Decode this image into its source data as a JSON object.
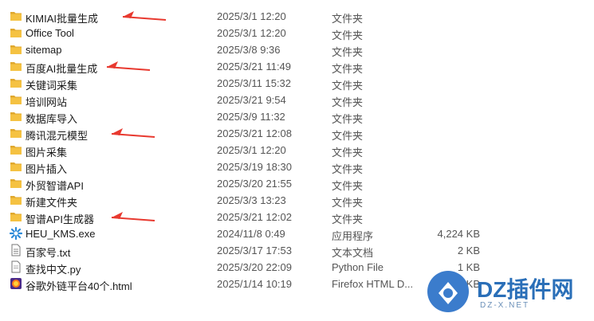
{
  "files": [
    {
      "name": "KIMIAI批量生成",
      "date": "2025/3/1 12:20",
      "type": "文件夹",
      "size": "",
      "icon": "folder-icon",
      "arrow": true
    },
    {
      "name": "Office Tool",
      "date": "2025/3/1 12:20",
      "type": "文件夹",
      "size": "",
      "icon": "folder-icon",
      "arrow": false
    },
    {
      "name": "sitemap",
      "date": "2025/3/8 9:36",
      "type": "文件夹",
      "size": "",
      "icon": "folder-icon",
      "arrow": false
    },
    {
      "name": "百度AI批量生成",
      "date": "2025/3/21 11:49",
      "type": "文件夹",
      "size": "",
      "icon": "folder-icon",
      "arrow": true
    },
    {
      "name": "关键词采集",
      "date": "2025/3/11 15:32",
      "type": "文件夹",
      "size": "",
      "icon": "folder-icon",
      "arrow": false
    },
    {
      "name": "培训网站",
      "date": "2025/3/21 9:54",
      "type": "文件夹",
      "size": "",
      "icon": "folder-icon",
      "arrow": false
    },
    {
      "name": "数据库导入",
      "date": "2025/3/9 11:32",
      "type": "文件夹",
      "size": "",
      "icon": "folder-icon",
      "arrow": false
    },
    {
      "name": "腾讯混元模型",
      "date": "2025/3/21 12:08",
      "type": "文件夹",
      "size": "",
      "icon": "folder-icon",
      "arrow": true
    },
    {
      "name": "图片采集",
      "date": "2025/3/1 12:20",
      "type": "文件夹",
      "size": "",
      "icon": "folder-icon",
      "arrow": false
    },
    {
      "name": "图片插入",
      "date": "2025/3/19 18:30",
      "type": "文件夹",
      "size": "",
      "icon": "folder-icon",
      "arrow": false
    },
    {
      "name": "外贸智谱API",
      "date": "2025/3/20 21:55",
      "type": "文件夹",
      "size": "",
      "icon": "folder-icon",
      "arrow": false
    },
    {
      "name": "新建文件夹",
      "date": "2025/3/3 13:23",
      "type": "文件夹",
      "size": "",
      "icon": "folder-icon",
      "arrow": false
    },
    {
      "name": "智谱API生成器",
      "date": "2025/3/21 12:02",
      "type": "文件夹",
      "size": "",
      "icon": "folder-icon",
      "arrow": true
    },
    {
      "name": "HEU_KMS.exe",
      "date": "2024/11/8 0:49",
      "type": "应用程序",
      "size": "4,224 KB",
      "icon": "exe-icon",
      "arrow": false
    },
    {
      "name": "百家号.txt",
      "date": "2025/3/17 17:53",
      "type": "文本文档",
      "size": "2 KB",
      "icon": "txt-icon",
      "arrow": false
    },
    {
      "name": "查找中文.py",
      "date": "2025/3/20 22:09",
      "type": "Python File",
      "size": "1 KB",
      "icon": "py-icon",
      "arrow": false
    },
    {
      "name": "谷歌外链平台40个.html",
      "date": "2025/1/14 10:19",
      "type": "Firefox HTML D...",
      "size": "3 KB",
      "icon": "html-icon",
      "arrow": false
    }
  ],
  "watermark": {
    "text": "DZ插件网",
    "sub": "DZ-X.NET"
  },
  "colors": {
    "folder": "#f5c242",
    "arrow": "#e8392f",
    "watermark": "#2a6fb8"
  }
}
